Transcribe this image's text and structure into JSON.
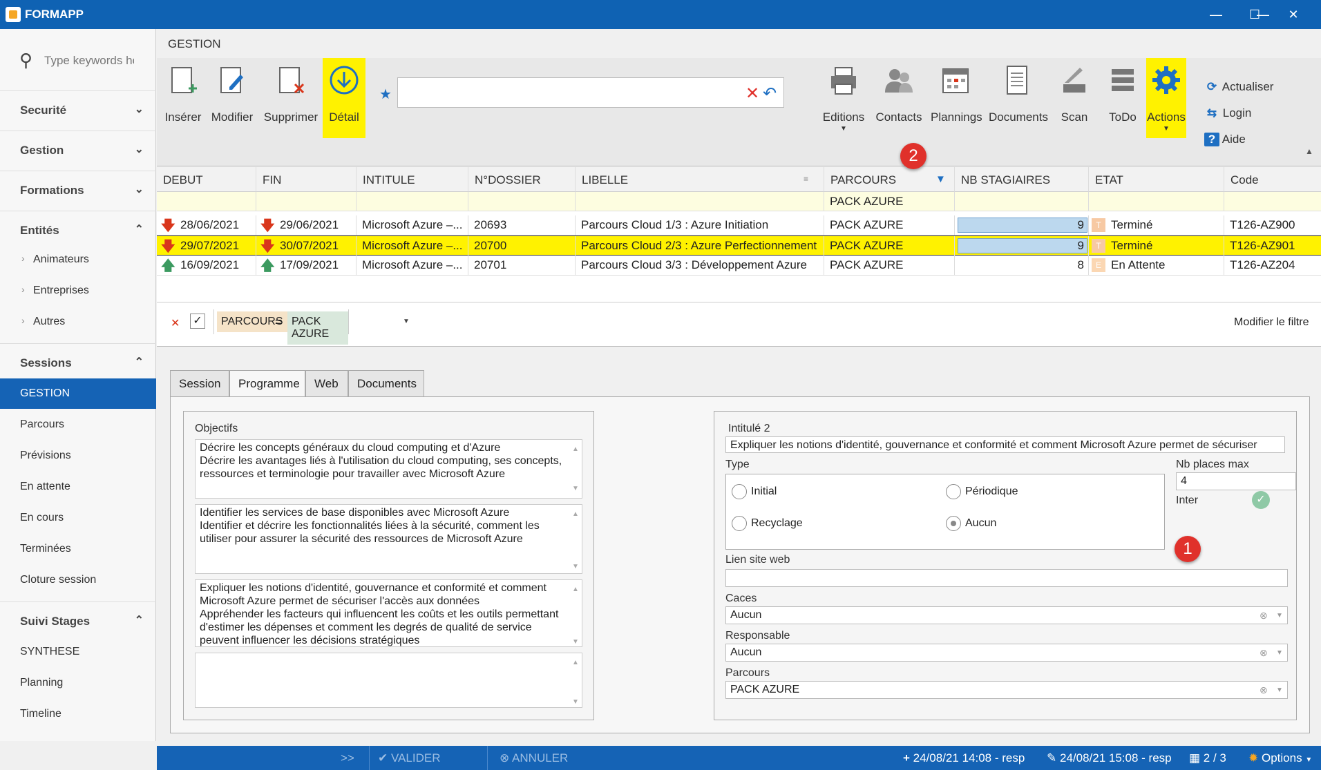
{
  "app": {
    "title": "FORMAPP"
  },
  "window": {
    "minimize": "—",
    "maximize": "☐",
    "close": "✕"
  },
  "sidebar": {
    "search_placeholder": "Type keywords he",
    "groups": [
      {
        "label": "Securité",
        "chev": "⌄"
      },
      {
        "label": "Gestion",
        "chev": "⌄"
      },
      {
        "label": "Formations",
        "chev": "⌄"
      },
      {
        "label": "Entités",
        "chev": "⌃"
      },
      {
        "label": "Sessions",
        "chev": "⌃"
      },
      {
        "label": "Suivi Stages",
        "chev": "⌃"
      }
    ],
    "entites_items": [
      "Animateurs",
      "Entreprises",
      "Autres"
    ],
    "sessions_items": [
      "GESTION",
      "Parcours",
      "Prévisions",
      "En attente",
      "En cours",
      "Terminées",
      "Cloture session"
    ],
    "suivi_items": [
      "SYNTHESE",
      "Planning",
      "Timeline"
    ]
  },
  "section_title": "GESTION",
  "ribbon": {
    "inserer": "Insérer",
    "modifier": "Modifier",
    "supprimer": "Supprimer",
    "detail": "Détail",
    "search_value": "",
    "editions": "Editions",
    "contacts": "Contacts",
    "plannings": "Plannings",
    "documents": "Documents",
    "scan": "Scan",
    "todo": "ToDo",
    "actions": "Actions",
    "actualiser": "Actualiser",
    "login": "Login",
    "aide": "Aide"
  },
  "grid": {
    "columns": [
      "DEBUT",
      "FIN",
      "INTITULE",
      "N°DOSSIER",
      "LIBELLE",
      "PARCOURS",
      "NB STAGIAIRES",
      "ETAT",
      "Code"
    ],
    "filter_row_value": "PACK AZURE",
    "rows": [
      {
        "debut": "28/06/2021",
        "fin": "29/06/2021",
        "intitule": "Microsoft Azure –...",
        "dossier": "20693",
        "libelle": "Parcours Cloud 1/3 : Azure Initiation",
        "parcours": "PACK AZURE",
        "nb": "9",
        "etat_letter": "T",
        "etat": "Terminé",
        "code": "T126-AZ900"
      },
      {
        "debut": "29/07/2021",
        "fin": "30/07/2021",
        "intitule": "Microsoft Azure –...",
        "dossier": "20700",
        "libelle": "Parcours Cloud 2/3 : Azure Perfectionnement",
        "parcours": "PACK AZURE",
        "nb": "9",
        "etat_letter": "T",
        "etat": "Terminé",
        "code": "T126-AZ901"
      },
      {
        "debut": "16/09/2021",
        "fin": "17/09/2021",
        "intitule": "Microsoft Azure –...",
        "dossier": "20701",
        "libelle": "Parcours Cloud 3/3 : Développement Azure",
        "parcours": "PACK AZURE",
        "nb": "8",
        "etat_letter": "E",
        "etat": "En Attente",
        "code": "T126-AZ204"
      }
    ]
  },
  "filter": {
    "field": "PARCOURS",
    "op": "=",
    "value": "PACK AZURE",
    "edit_label": "Modifier le filtre"
  },
  "tabs": [
    "Session",
    "Programme",
    "Web",
    "Documents"
  ],
  "programme": {
    "objectifs_label": "Objectifs",
    "obj1": "Décrire les concepts généraux du cloud computing et d'Azure\nDécrire les avantages liés à l'utilisation du cloud computing, ses concepts, ressources et terminologie pour travailler avec Microsoft Azure",
    "obj2": "Identifier les services de base disponibles avec Microsoft Azure\nIdentifier et décrire les fonctionnalités liées à la sécurité, comment les utiliser pour assurer la sécurité des ressources de Microsoft Azure",
    "obj3": "Expliquer les notions d'identité, gouvernance et conformité et comment Microsoft Azure permet de sécuriser l'accès aux données\nAppréhender les facteurs qui influencent les coûts et les outils permettant d'estimer les dépenses et comment les degrés de qualité de service peuvent influencer les décisions stratégiques",
    "obj4": "",
    "intitule2_label": "Intitulé 2",
    "intitule2_value": "Expliquer les notions d'identité, gouvernance et conformité et comment Microsoft Azure permet de sécuriser",
    "type_label": "Type",
    "types": [
      "Initial",
      "Périodique",
      "Recyclage",
      "Aucun"
    ],
    "nb_places_label": "Nb places max",
    "nb_places_value": "4",
    "inter_label": "Inter",
    "lien_label": "Lien site web",
    "lien_value": "",
    "caces_label": "Caces",
    "caces_value": "Aucun",
    "responsable_label": "Responsable",
    "responsable_value": "Aucun",
    "parcours_label": "Parcours",
    "parcours_value": "PACK AZURE"
  },
  "badges": {
    "one": "1",
    "two": "2"
  },
  "status": {
    "arrows": ">>",
    "valider": "VALIDER",
    "annuler": "ANNULER",
    "created": "24/08/21 14:08 - resp",
    "modified": "24/08/21 15:08 - resp",
    "pager": "2 / 3",
    "options": "Options"
  },
  "colors": {
    "titlebar": "#0f62b3",
    "highlight": "#fff200",
    "accent": "#1563b5",
    "red_arrow": "#d9361b",
    "green_arrow": "#3c9a60"
  }
}
